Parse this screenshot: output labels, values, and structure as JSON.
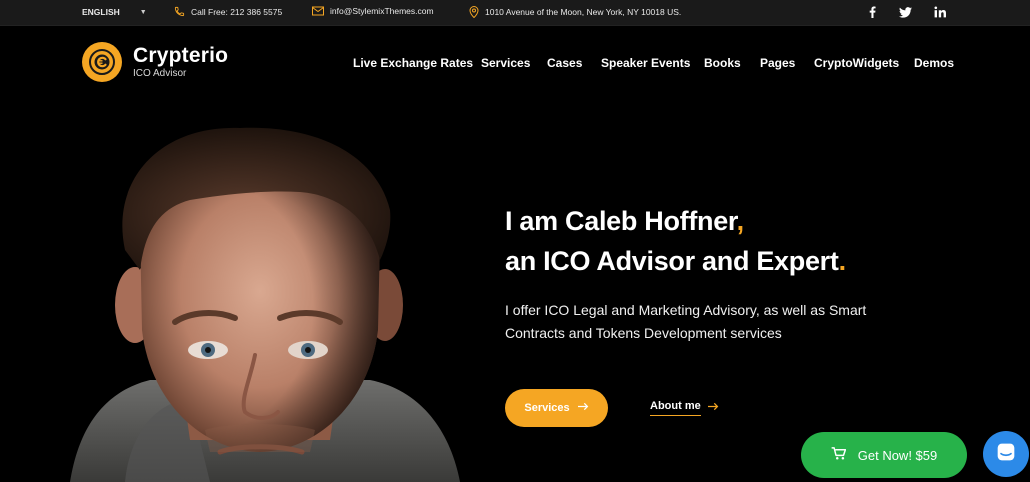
{
  "topbar": {
    "language": "ENGLISH",
    "phone": "Call Free: 212 386 5575",
    "email": "info@StylemixThemes.com",
    "address": "1010 Avenue of the Moon, New York, NY 10018 US.",
    "socials": [
      "facebook-icon",
      "twitter-icon",
      "linkedin-icon"
    ]
  },
  "logo": {
    "brand": "Crypterio",
    "tagline": "ICO Advisor"
  },
  "nav": {
    "items": [
      "Live Exchange Rates",
      "Services",
      "Cases",
      "Speaker Events",
      "Books",
      "Pages",
      "CryptoWidgets",
      "Demos"
    ]
  },
  "hero": {
    "line1": "I am Caleb Hoffner",
    "line1_punct": ",",
    "line2": "an ICO Advisor and Expert",
    "line2_punct": ".",
    "description": "I offer ICO Legal and Marketing Advisory, as well as Smart Contracts and Tokens Development services",
    "services_button": "Services",
    "about_link": "About me"
  },
  "cta": {
    "get_now": "Get Now! $59"
  },
  "colors": {
    "accent": "#f5a623",
    "cta_green": "#27b24a",
    "chat_blue": "#2c8ae8",
    "background": "#000000",
    "topbar": "#1a1a1a"
  }
}
